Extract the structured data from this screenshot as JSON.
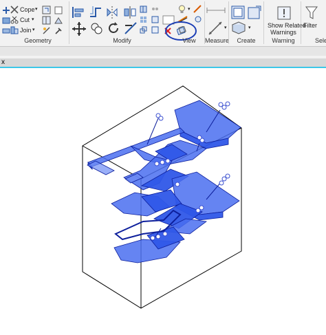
{
  "ribbon": {
    "geometry": {
      "cope_label": "Cope",
      "cut_label": "Cut",
      "join_label": "Join",
      "title": "Geometry"
    },
    "modify": {
      "title": "Modify"
    },
    "view": {
      "title": "View"
    },
    "measure": {
      "title": "Measure"
    },
    "create": {
      "title": "Create"
    },
    "warning": {
      "show_related_line1": "Show Related",
      "show_related_line2": "Warnings",
      "title": "Warning"
    },
    "selection": {
      "filter_label": "Filter",
      "title_partial": "Selec"
    }
  },
  "view_tab": {
    "label": "x"
  },
  "annotation": {
    "color": "#1a3db5"
  },
  "model": {
    "color": "#2f57e8",
    "edge": "#0d1f9c",
    "box": "#000000"
  }
}
